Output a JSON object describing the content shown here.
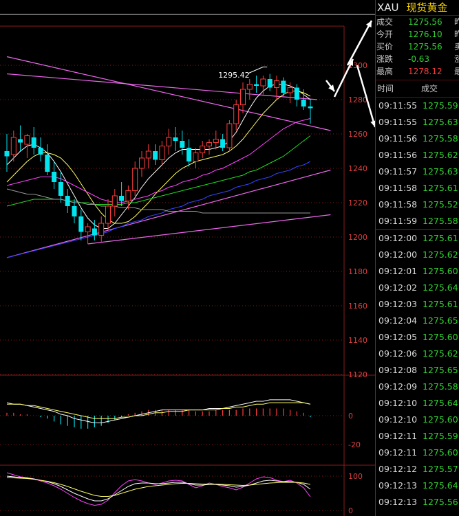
{
  "panel": {
    "symbol": "XAU",
    "name": "现货黄金",
    "quote_rows": [
      {
        "label": "成交",
        "value": "1275.56",
        "extra": "昨",
        "color": "green"
      },
      {
        "label": "今开",
        "value": "1276.10",
        "extra": "昨",
        "color": "green"
      },
      {
        "label": "买价",
        "value": "1275.56",
        "extra": "卖",
        "color": "green"
      },
      {
        "label": "涨跌",
        "value": "-0.63",
        "extra": "涨",
        "color": "green"
      },
      {
        "label": "最高",
        "value": "1278.12",
        "extra": "最",
        "color": "red"
      }
    ],
    "tick_header": {
      "time": "时间",
      "price": "成交"
    },
    "ticks": [
      {
        "time": "09:11:55",
        "price": "1275.59"
      },
      {
        "time": "09:11:55",
        "price": "1275.63"
      },
      {
        "time": "09:11:56",
        "price": "1275.58"
      },
      {
        "time": "09:11:56",
        "price": "1275.62"
      },
      {
        "time": "09:11:57",
        "price": "1275.63"
      },
      {
        "time": "09:11:58",
        "price": "1275.61"
      },
      {
        "time": "09:11:58",
        "price": "1275.52"
      },
      {
        "time": "09:11:59",
        "price": "1275.58"
      },
      {
        "time": "09:12:00",
        "price": "1275.61"
      },
      {
        "time": "09:12:00",
        "price": "1275.62"
      },
      {
        "time": "09:12:01",
        "price": "1275.60"
      },
      {
        "time": "09:12:02",
        "price": "1275.64"
      },
      {
        "time": "09:12:03",
        "price": "1275.61"
      },
      {
        "time": "09:12:04",
        "price": "1275.65"
      },
      {
        "time": "09:12:05",
        "price": "1275.60"
      },
      {
        "time": "09:12:06",
        "price": "1275.62"
      },
      {
        "time": "09:12:08",
        "price": "1275.65"
      },
      {
        "time": "09:12:09",
        "price": "1275.58"
      },
      {
        "time": "09:12:10",
        "price": "1275.64"
      },
      {
        "time": "09:12:10",
        "price": "1275.60"
      },
      {
        "time": "09:12:11",
        "price": "1275.59"
      },
      {
        "time": "09:12:11",
        "price": "1275.60"
      },
      {
        "time": "09:12:12",
        "price": "1275.57"
      },
      {
        "time": "09:12:13",
        "price": "1275.64"
      },
      {
        "time": "09:12:13",
        "price": "1275.56"
      }
    ]
  },
  "colors": {
    "up": "#ff3c3c",
    "down": "#00e5ee",
    "ma_white": "#ffffff",
    "ma_yellow": "#ffff66",
    "ma_magenta": "#ff44ff",
    "ma_green": "#22dd22",
    "ma_blue": "#3344ff",
    "ma_gray": "#9a9a9a",
    "trend": "#ee66ee",
    "grid": "#8a1a1a"
  },
  "chart_data": [
    {
      "type": "candlestick",
      "name": "",
      "y_axis_ticks": [
        "1120",
        "1140",
        "1160",
        "1180",
        "1200",
        "1220",
        "1240",
        "1260",
        "1280",
        "1300"
      ],
      "ylim": [
        1107,
        1322
      ],
      "annotation": "1295.42",
      "candles": [
        {
          "o": 1250,
          "h": 1260,
          "l": 1238,
          "c": 1247
        },
        {
          "o": 1248,
          "h": 1262,
          "l": 1244,
          "c": 1258
        },
        {
          "o": 1257,
          "h": 1265,
          "l": 1250,
          "c": 1255
        },
        {
          "o": 1254,
          "h": 1260,
          "l": 1246,
          "c": 1259
        },
        {
          "o": 1258,
          "h": 1264,
          "l": 1248,
          "c": 1252
        },
        {
          "o": 1252,
          "h": 1258,
          "l": 1244,
          "c": 1248
        },
        {
          "o": 1248,
          "h": 1254,
          "l": 1236,
          "c": 1238
        },
        {
          "o": 1238,
          "h": 1244,
          "l": 1228,
          "c": 1232
        },
        {
          "o": 1232,
          "h": 1238,
          "l": 1220,
          "c": 1224
        },
        {
          "o": 1224,
          "h": 1228,
          "l": 1214,
          "c": 1218
        },
        {
          "o": 1218,
          "h": 1222,
          "l": 1208,
          "c": 1212
        },
        {
          "o": 1212,
          "h": 1216,
          "l": 1198,
          "c": 1203
        },
        {
          "o": 1203,
          "h": 1208,
          "l": 1196,
          "c": 1206
        },
        {
          "o": 1205,
          "h": 1210,
          "l": 1198,
          "c": 1201
        },
        {
          "o": 1201,
          "h": 1212,
          "l": 1197,
          "c": 1208
        },
        {
          "o": 1208,
          "h": 1222,
          "l": 1204,
          "c": 1218
        },
        {
          "o": 1218,
          "h": 1228,
          "l": 1212,
          "c": 1224
        },
        {
          "o": 1224,
          "h": 1232,
          "l": 1218,
          "c": 1221
        },
        {
          "o": 1221,
          "h": 1230,
          "l": 1216,
          "c": 1227
        },
        {
          "o": 1227,
          "h": 1244,
          "l": 1224,
          "c": 1240
        },
        {
          "o": 1240,
          "h": 1250,
          "l": 1235,
          "c": 1246
        },
        {
          "o": 1246,
          "h": 1254,
          "l": 1240,
          "c": 1250
        },
        {
          "o": 1250,
          "h": 1254,
          "l": 1242,
          "c": 1245
        },
        {
          "o": 1245,
          "h": 1256,
          "l": 1242,
          "c": 1253
        },
        {
          "o": 1253,
          "h": 1263,
          "l": 1248,
          "c": 1258
        },
        {
          "o": 1258,
          "h": 1264,
          "l": 1250,
          "c": 1256
        },
        {
          "o": 1256,
          "h": 1262,
          "l": 1248,
          "c": 1252
        },
        {
          "o": 1252,
          "h": 1257,
          "l": 1241,
          "c": 1244
        },
        {
          "o": 1244,
          "h": 1252,
          "l": 1240,
          "c": 1249
        },
        {
          "o": 1249,
          "h": 1256,
          "l": 1246,
          "c": 1253
        },
        {
          "o": 1253,
          "h": 1257,
          "l": 1248,
          "c": 1255
        },
        {
          "o": 1255,
          "h": 1262,
          "l": 1251,
          "c": 1257
        },
        {
          "o": 1257,
          "h": 1260,
          "l": 1250,
          "c": 1252
        },
        {
          "o": 1252,
          "h": 1268,
          "l": 1250,
          "c": 1266
        },
        {
          "o": 1266,
          "h": 1280,
          "l": 1262,
          "c": 1277
        },
        {
          "o": 1277,
          "h": 1290,
          "l": 1272,
          "c": 1286
        },
        {
          "o": 1286,
          "h": 1292,
          "l": 1280,
          "c": 1289
        },
        {
          "o": 1289,
          "h": 1294,
          "l": 1284,
          "c": 1288
        },
        {
          "o": 1288,
          "h": 1294,
          "l": 1283,
          "c": 1292
        },
        {
          "o": 1292,
          "h": 1295,
          "l": 1285,
          "c": 1287
        },
        {
          "o": 1287,
          "h": 1294,
          "l": 1280,
          "c": 1291
        },
        {
          "o": 1291,
          "h": 1293,
          "l": 1282,
          "c": 1284
        },
        {
          "o": 1284,
          "h": 1290,
          "l": 1278,
          "c": 1287
        },
        {
          "o": 1287,
          "h": 1289,
          "l": 1276,
          "c": 1280
        },
        {
          "o": 1280,
          "h": 1286,
          "l": 1274,
          "c": 1276
        },
        {
          "o": 1276,
          "h": 1280,
          "l": 1266,
          "c": 1275
        }
      ],
      "moving_averages": [
        {
          "color_key": "ma_white",
          "values": [
            1242,
            1246,
            1250,
            1253,
            1254,
            1252,
            1249,
            1244,
            1238,
            1231,
            1224,
            1217,
            1211,
            1207,
            1205,
            1205,
            1208,
            1213,
            1218,
            1223,
            1229,
            1234,
            1238,
            1242,
            1246,
            1249,
            1251,
            1251,
            1251,
            1251,
            1251,
            1252,
            1253,
            1256,
            1261,
            1268,
            1275,
            1281,
            1285,
            1288,
            1289,
            1289,
            1288,
            1286,
            1283,
            1280
          ]
        },
        {
          "color_key": "ma_yellow",
          "values": [
            1232,
            1236,
            1240,
            1244,
            1247,
            1249,
            1249,
            1248,
            1246,
            1242,
            1237,
            1231,
            1225,
            1219,
            1214,
            1210,
            1208,
            1208,
            1209,
            1212,
            1216,
            1220,
            1225,
            1229,
            1233,
            1237,
            1240,
            1242,
            1244,
            1245,
            1246,
            1247,
            1248,
            1250,
            1253,
            1257,
            1262,
            1267,
            1272,
            1276,
            1280,
            1283,
            1285,
            1285,
            1284,
            1282
          ]
        },
        {
          "color_key": "ma_magenta",
          "values": [
            1230,
            1231,
            1232,
            1233,
            1234,
            1235,
            1235,
            1235,
            1234,
            1232,
            1230,
            1228,
            1226,
            1224,
            1222,
            1221,
            1220,
            1220,
            1221,
            1222,
            1223,
            1224,
            1226,
            1227,
            1229,
            1230,
            1232,
            1233,
            1234,
            1236,
            1237,
            1239,
            1240,
            1242,
            1244,
            1246,
            1248,
            1251,
            1254,
            1257,
            1260,
            1263,
            1265,
            1267,
            1268,
            1269
          ]
        },
        {
          "color_key": "ma_green",
          "values": [
            1218,
            1219,
            1220,
            1221,
            1222,
            1222,
            1222,
            1222,
            1222,
            1221,
            1221,
            1220,
            1220,
            1219,
            1219,
            1219,
            1219,
            1219,
            1220,
            1220,
            1221,
            1222,
            1223,
            1224,
            1225,
            1226,
            1227,
            1228,
            1229,
            1230,
            1231,
            1232,
            1233,
            1234,
            1235,
            1236,
            1238,
            1239,
            1241,
            1243,
            1245,
            1247,
            1250,
            1253,
            1256,
            1259
          ]
        },
        {
          "color_key": "ma_blue",
          "values": [
            1188,
            1189,
            1190,
            1191,
            1192,
            1193,
            1194,
            1195,
            1196,
            1197,
            1198,
            1199,
            1200,
            1201,
            1202,
            1203,
            1205,
            1206,
            1208,
            1209,
            1210,
            1212,
            1213,
            1214,
            1216,
            1217,
            1218,
            1220,
            1221,
            1222,
            1224,
            1225,
            1226,
            1227,
            1229,
            1230,
            1231,
            1233,
            1234,
            1235,
            1237,
            1238,
            1239,
            1241,
            1242,
            1244
          ]
        },
        {
          "color_key": "ma_gray",
          "values": [
            1228,
            1227,
            1226,
            1225,
            1225,
            1224,
            1223,
            1222,
            1222,
            1221,
            1220,
            1220,
            1219,
            1219,
            1218,
            1218,
            1218,
            1217,
            1217,
            1217,
            1216,
            1216,
            1216,
            1216,
            1215,
            1215,
            1215,
            1215,
            1215,
            1214,
            1214,
            1214,
            1214,
            1214,
            1214,
            1214,
            1214,
            1214,
            1214,
            1214,
            1214,
            1214,
            1214,
            1214,
            1214,
            1214
          ]
        }
      ],
      "trendlines": [
        {
          "from": [
            0,
            1305
          ],
          "to": [
            48,
            1262
          ]
        },
        {
          "from": [
            0,
            1295
          ],
          "to": [
            46,
            1280
          ]
        },
        {
          "from": [
            0,
            1188
          ],
          "to": [
            48,
            1239
          ]
        },
        {
          "from": [
            12,
            1196
          ],
          "to": [
            48,
            1213
          ]
        }
      ]
    },
    {
      "type": "bar",
      "name": "",
      "y_axis_ticks": [
        "0",
        "-20"
      ],
      "ylim": [
        -24,
        14
      ],
      "values": [
        2,
        2,
        1,
        1,
        0,
        -1,
        -2,
        -4,
        -6,
        -7,
        -8,
        -9,
        -9,
        -8,
        -7,
        -5,
        -3,
        -1,
        1,
        2,
        3,
        4,
        4,
        4,
        4,
        4,
        4,
        4,
        3,
        3,
        3,
        4,
        4,
        4,
        4,
        5,
        5,
        5,
        5,
        5,
        5,
        5,
        4,
        3,
        2,
        -1
      ],
      "lines": [
        {
          "color_key": "ma_white",
          "values": [
            9,
            8,
            8,
            7,
            6,
            5,
            4,
            3,
            1,
            0,
            -2,
            -3,
            -4,
            -5,
            -5,
            -4,
            -3,
            -2,
            -1,
            0,
            1,
            2,
            3,
            4,
            4,
            4,
            4,
            4,
            4,
            4,
            5,
            5,
            5,
            6,
            7,
            8,
            9,
            10,
            10,
            11,
            11,
            11,
            11,
            10,
            9,
            8
          ]
        },
        {
          "color_key": "ma_yellow",
          "values": [
            8,
            8,
            8,
            7,
            7,
            6,
            5,
            4,
            3,
            2,
            1,
            0,
            -1,
            -2,
            -2,
            -2,
            -2,
            -1,
            -1,
            0,
            0,
            1,
            2,
            2,
            3,
            3,
            3,
            4,
            4,
            4,
            4,
            4,
            5,
            5,
            6,
            6,
            7,
            8,
            8,
            9,
            9,
            9,
            9,
            9,
            9,
            8
          ]
        }
      ]
    },
    {
      "type": "line",
      "name": "",
      "y_axis_ticks": [
        "100",
        "0"
      ],
      "ylim": [
        -10,
        125
      ],
      "series": [
        {
          "color_key": "ma_magenta",
          "values": [
            110,
            104,
            98,
            96,
            92,
            86,
            80,
            72,
            62,
            50,
            38,
            28,
            20,
            15,
            18,
            30,
            52,
            72,
            86,
            90,
            86,
            80,
            76,
            80,
            86,
            88,
            86,
            76,
            66,
            72,
            80,
            76,
            70,
            66,
            60,
            68,
            80,
            92,
            98,
            96,
            88,
            84,
            88,
            80,
            66,
            40
          ]
        },
        {
          "color_key": "ma_white",
          "values": [
            100,
            98,
            96,
            94,
            92,
            88,
            84,
            78,
            70,
            60,
            50,
            42,
            34,
            28,
            28,
            34,
            46,
            58,
            70,
            78,
            80,
            80,
            78,
            78,
            80,
            82,
            82,
            78,
            74,
            74,
            76,
            76,
            74,
            72,
            68,
            70,
            74,
            80,
            86,
            88,
            86,
            84,
            84,
            82,
            76,
            62
          ]
        },
        {
          "color_key": "ma_yellow",
          "values": [
            96,
            95,
            94,
            93,
            91,
            88,
            85,
            81,
            76,
            70,
            63,
            56,
            50,
            44,
            41,
            41,
            44,
            50,
            56,
            62,
            66,
            70,
            72,
            74,
            76,
            78,
            79,
            79,
            78,
            77,
            77,
            77,
            76,
            75,
            74,
            73,
            74,
            76,
            78,
            80,
            81,
            82,
            82,
            82,
            80,
            76
          ]
        }
      ]
    }
  ]
}
